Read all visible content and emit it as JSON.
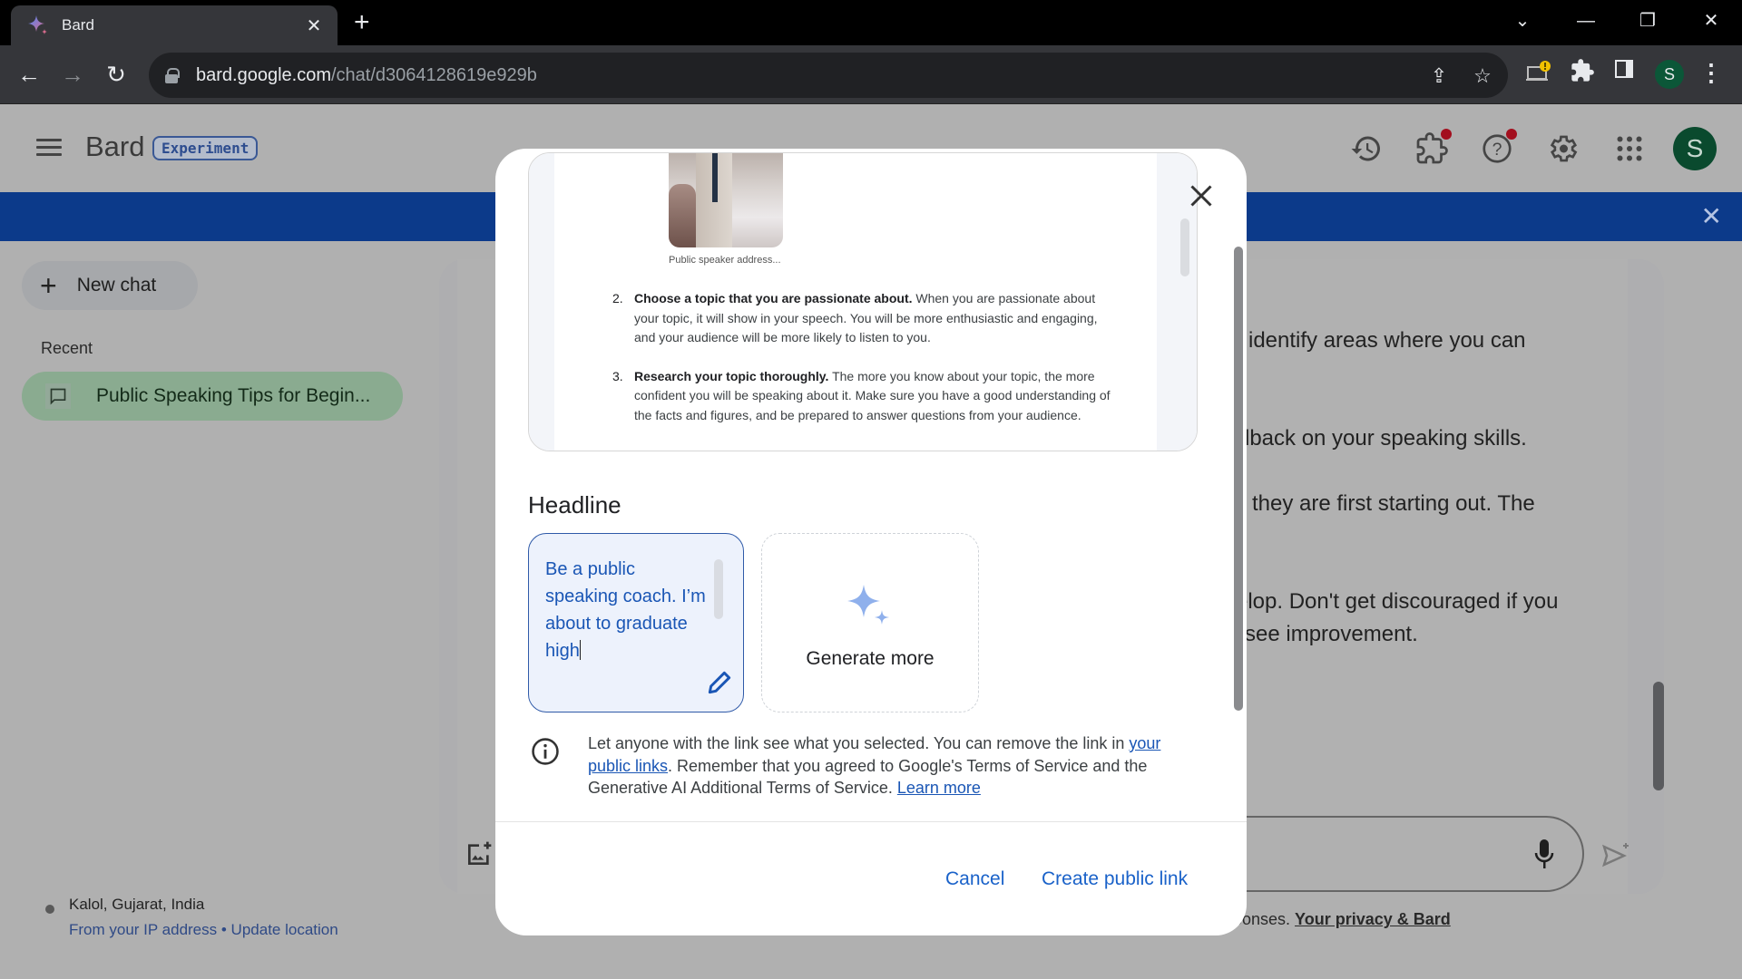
{
  "browser": {
    "tab_title": "Bard",
    "new_tab_symbol": "+",
    "tab_close_symbol": "✕",
    "url_host": "bard.google.com",
    "url_path": "/chat/d3064128619e929b",
    "profile_initial": "S",
    "window_controls": {
      "tab_search": "⌄",
      "minimize": "—",
      "restore": "❐",
      "close": "✕"
    }
  },
  "app": {
    "brand": "Bard",
    "badge": "Experiment",
    "avatar_initial": "S",
    "header_icons": [
      "history-icon",
      "extensions-icon",
      "help-icon",
      "settings-icon",
      "apps-grid-icon"
    ],
    "notification_color": "#a30f1e",
    "banner_color": "#0c3a8a"
  },
  "sidebar": {
    "new_chat_label": "New chat",
    "recent_label": "Recent",
    "recent_items": [
      {
        "label": "Public Speaking Tips for Begin..."
      }
    ],
    "location_city": "Kalol, Gujarat, India",
    "location_source": "From your IP address",
    "location_separator": " • ",
    "update_location": "Update location"
  },
  "background_chat": {
    "lines": [
      "identify areas where you can",
      "lback on your speaking skills.",
      "they are first starting out. The",
      "elop. Don't get discouraged if you",
      "see improvement."
    ],
    "privacy_prefix": "sponses. ",
    "privacy_link": "Your privacy & Bard"
  },
  "modal": {
    "preview": {
      "image_caption": "Public speaker address...",
      "items": [
        {
          "number": "2.",
          "bold": "Choose a topic that you are passionate about.",
          "text": " When you are passionate about your topic, it will show in your speech. You will be more enthusiastic and engaging, and your audience will be more likely to listen to you."
        },
        {
          "number": "3.",
          "bold": "Research your topic thoroughly.",
          "text": " The more you know about your topic, the more confident you will be speaking about it. Make sure you have a good understanding of the facts and figures, and be prepared to answer questions from your audience."
        }
      ]
    },
    "headline_title": "Headline",
    "headline_value": "Be a public speaking coach. I’m about to graduate high",
    "generate_more_label": "Generate more",
    "info": {
      "text_1": "Let anyone with the link see what you selected. You can remove the link in ",
      "link_1": "your public links",
      "text_2": ". Remember that you agreed to Google's Terms of Service and the Generative AI Additional Terms of Service. ",
      "link_2": "Learn more"
    },
    "cancel_label": "Cancel",
    "create_label": "Create public link",
    "accent_color": "#1a62c9"
  }
}
